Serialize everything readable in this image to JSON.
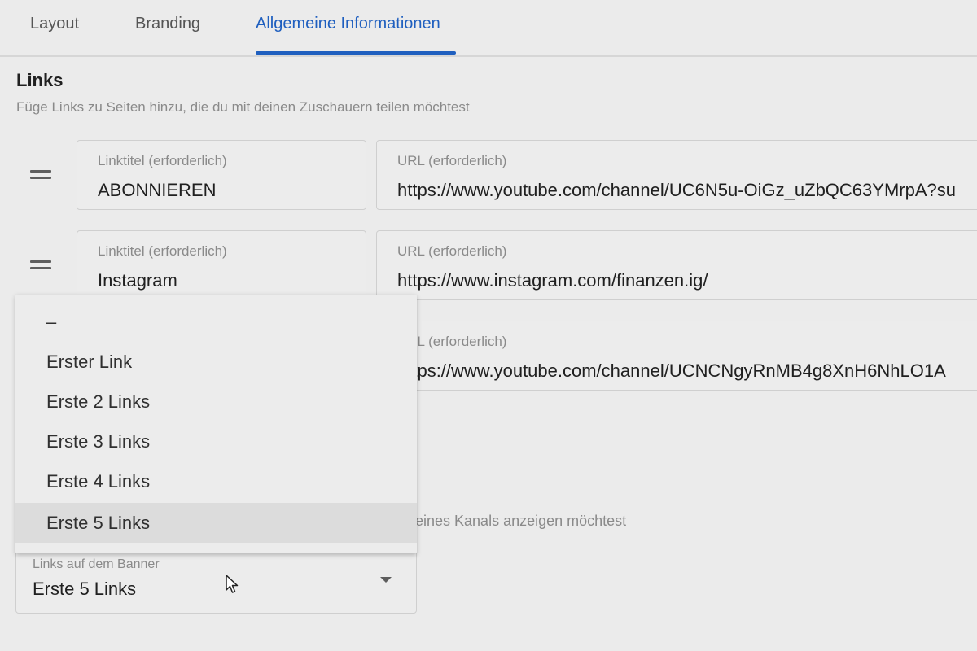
{
  "tabs": [
    {
      "label": "Layout"
    },
    {
      "label": "Branding"
    },
    {
      "label": "Allgemeine Informationen",
      "active": true
    }
  ],
  "links_section": {
    "title": "Links",
    "description": "Füge Links zu Seiten hinzu, die du mit deinen Zuschauern teilen möchtest",
    "rows": [
      {
        "title_label": "Linktitel (erforderlich)",
        "title_value": "ABONNIEREN",
        "url_label": "URL (erforderlich)",
        "url_value": "https://www.youtube.com/channel/UC6N5u-OiGz_uZbQC63YMrpA?su"
      },
      {
        "title_label": "Linktitel (erforderlich)",
        "title_value": "Instagram",
        "url_label": "URL (erforderlich)",
        "url_value": "https://www.instagram.com/finanzen.ig/"
      },
      {
        "url_label": "URL (erforderlich)",
        "url_value": "https://www.youtube.com/channel/UCNCNgyRnMB4g8XnH6NhLO1A"
      }
    ]
  },
  "banner_section": {
    "description_visible": "eines Kanals anzeigen möchtest",
    "select_label": "Links auf dem Banner",
    "select_value": "Erste 5 Links"
  },
  "dropdown": {
    "options": [
      "–",
      "Erster Link",
      "Erste 2 Links",
      "Erste 3 Links",
      "Erste 4 Links",
      "Erste 5 Links"
    ],
    "selected_index": 5
  },
  "colors": {
    "accent": "#1f5fbf",
    "background": "#ebebeb",
    "muted_text": "#8a8a8a"
  }
}
